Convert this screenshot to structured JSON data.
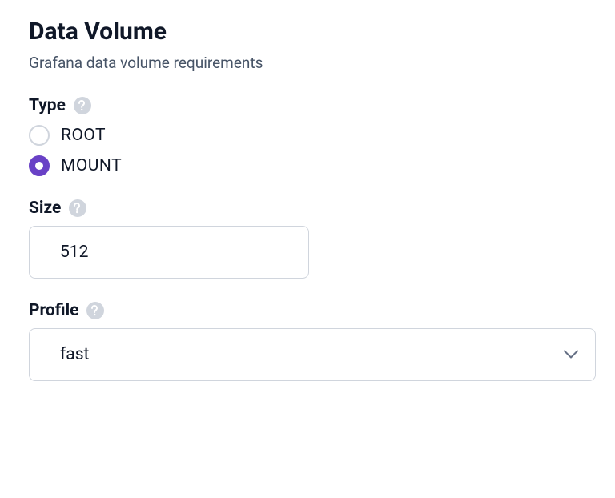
{
  "section": {
    "title": "Data Volume",
    "description": "Grafana data volume requirements"
  },
  "fields": {
    "type": {
      "label": "Type",
      "options": [
        "ROOT",
        "MOUNT"
      ],
      "selected": "MOUNT"
    },
    "size": {
      "label": "Size",
      "value": "512"
    },
    "profile": {
      "label": "Profile",
      "value": "fast"
    }
  }
}
